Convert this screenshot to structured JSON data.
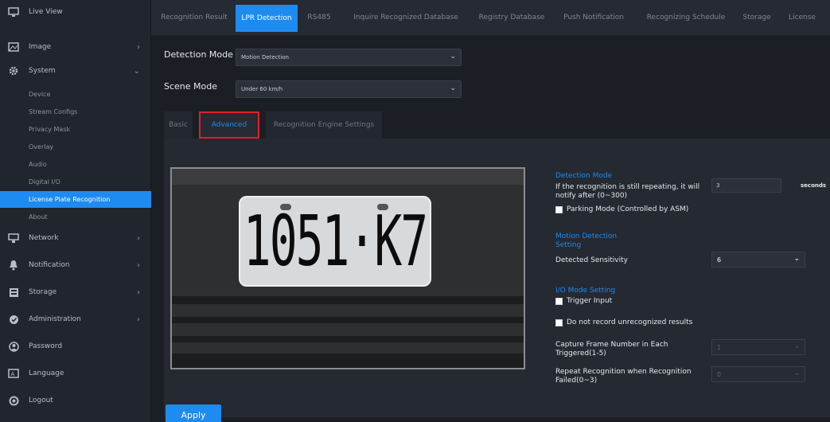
{
  "sidebar": {
    "items": [
      {
        "label": "Live View",
        "icon": "monitor-icon"
      },
      {
        "label": "Image",
        "icon": "image-icon"
      },
      {
        "label": "System",
        "icon": "gear-icon"
      },
      {
        "label": "Network",
        "icon": "network-icon"
      },
      {
        "label": "Notification",
        "icon": "bell-icon"
      },
      {
        "label": "Storage",
        "icon": "storage-icon"
      },
      {
        "label": "Administration",
        "icon": "shield-icon"
      },
      {
        "label": "Password",
        "icon": "user-icon"
      },
      {
        "label": "Language",
        "icon": "language-icon"
      },
      {
        "label": "Logout",
        "icon": "power-icon"
      }
    ],
    "system_sub": [
      "Device",
      "Stream Configs",
      "Privacy Mask",
      "Overlay",
      "Audio",
      "Digital I/O",
      "License Plate Recognition",
      "About"
    ],
    "active_sub": "License Plate Recognition"
  },
  "top_tabs": [
    "Recognition Result",
    "LPR Detection",
    "RS485",
    "Inquire Recognized Database",
    "Registry Database",
    "Push Notification",
    "Recognizing Schedule",
    "Storage",
    "License"
  ],
  "active_top_tab": "LPR Detection",
  "form": {
    "detection_mode_label": "Detection Mode",
    "detection_mode_value": "Motion Detection",
    "scene_mode_label": "Scene Mode",
    "scene_mode_value": "Under 60 km/h"
  },
  "sub_tabs": [
    "Basic",
    "Advanced",
    "Recognition Engine Settings"
  ],
  "active_sub_tab": "Advanced",
  "camera": {
    "plate_text": "1051·K7"
  },
  "settings": {
    "detection_mode_title": "Detection Mode",
    "repeat_text_line1": "If the recognition is still repeating, it will",
    "repeat_text_line2": "notify after (0~300)",
    "repeat_value": "3",
    "repeat_unit": "seconds",
    "parking_mode": "Parking Mode (Controlled by ASM)",
    "motion_title_line1": "Motion Detection",
    "motion_title_line2": "Setting",
    "sensitivity_label": "Detected Sensitivity",
    "sensitivity_value": "6",
    "io_title": "I/O Mode Setting",
    "trigger_input": "Trigger Input",
    "no_record": "Do not record unrecognized results",
    "capture_label_line1": "Capture Frame Number in Each",
    "capture_label_line2": "Triggered(1-5)",
    "capture_value": "1",
    "repeat_recog_line1": "Repeat Recognition when Recognition",
    "repeat_recog_line2": "Failed(0~3)",
    "repeat_recog_value": "0"
  },
  "apply_label": "Apply",
  "colors": {
    "accent": "#1e8bf0",
    "highlight_box": "#e0202a"
  }
}
